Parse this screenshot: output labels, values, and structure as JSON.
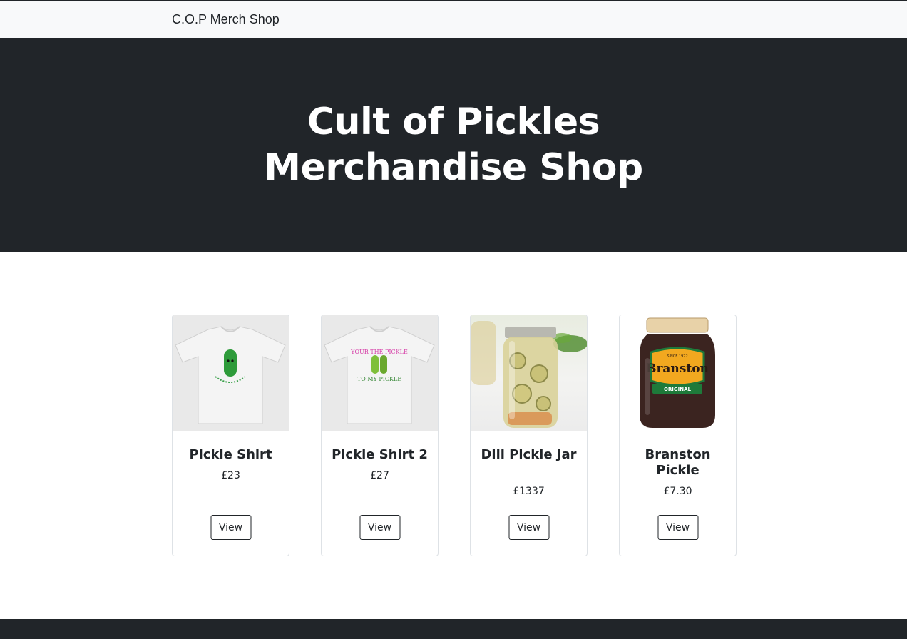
{
  "navbar": {
    "brand": "C.O.P Merch Shop"
  },
  "hero": {
    "title": "Cult of Pickles Merchandise Shop"
  },
  "products": [
    {
      "name": "Pickle Shirt",
      "price": "£23",
      "button": "View",
      "image": "tshirt-pickle-image"
    },
    {
      "name": "Pickle Shirt 2",
      "price": "£27",
      "button": "View",
      "image": "tshirt-two-pickles-image",
      "image_text": [
        "YOUR THE PICKLE",
        "TO MY PICKLE"
      ]
    },
    {
      "name": "Dill Pickle Jar",
      "price": "£1337",
      "button": "View",
      "image": "pickle-jar-photo"
    },
    {
      "name": "Branston Pickle",
      "price": "£7.30",
      "button": "View",
      "image": "branston-jar-photo",
      "image_text": [
        "Branston",
        "ORIGINAL",
        "SINCE 1922"
      ]
    }
  ],
  "colors": {
    "dark": "#212529",
    "navbar_bg": "#f8f9fa",
    "border": "#dee2e6"
  }
}
